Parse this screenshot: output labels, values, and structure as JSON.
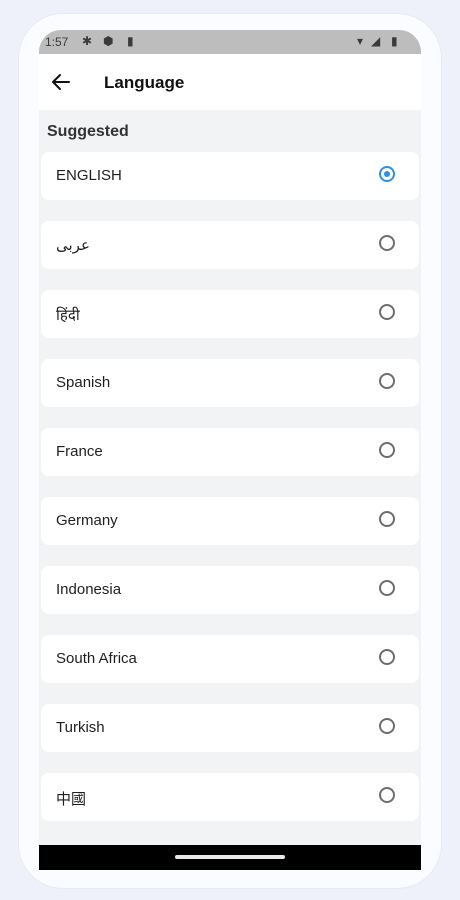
{
  "status": {
    "time": "1:57"
  },
  "header": {
    "title": "Language"
  },
  "section_title": "Suggested",
  "languages": [
    {
      "label": "ENGLISH",
      "selected": true
    },
    {
      "label": "عربى",
      "selected": false
    },
    {
      "label": "हिंदी",
      "selected": false
    },
    {
      "label": "Spanish",
      "selected": false
    },
    {
      "label": "France",
      "selected": false
    },
    {
      "label": "Germany",
      "selected": false
    },
    {
      "label": "Indonesia",
      "selected": false
    },
    {
      "label": "South Africa",
      "selected": false
    },
    {
      "label": "Turkish",
      "selected": false
    },
    {
      "label": "中國",
      "selected": false
    }
  ],
  "colors": {
    "accent": "#2f8fe6",
    "background": "#f2f3f5"
  }
}
